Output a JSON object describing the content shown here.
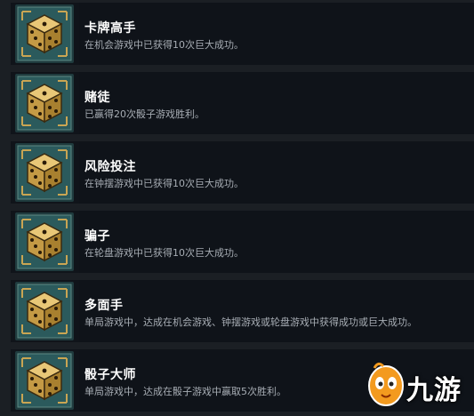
{
  "achievements": [
    {
      "title": "卡牌高手",
      "description": "在机会游戏中已获得10次巨大成功。",
      "icon": "dice-icon"
    },
    {
      "title": "赌徒",
      "description": "已赢得20次骰子游戏胜利。",
      "icon": "dice-icon"
    },
    {
      "title": "风险投注",
      "description": "在钟摆游戏中已获得10次巨大成功。",
      "icon": "dice-icon"
    },
    {
      "title": "骗子",
      "description": "在轮盘游戏中已获得10次巨大成功。",
      "icon": "dice-icon"
    },
    {
      "title": "多面手",
      "description": "单局游戏中，达成在机会游戏、钟摆游戏或轮盘游戏中获得成功或巨大成功。",
      "icon": "dice-icon"
    },
    {
      "title": "骰子大师",
      "description": "单局游戏中，达成在骰子游戏中赢取5次胜利。",
      "icon": "dice-icon"
    }
  ],
  "watermark": {
    "text": "九游",
    "icon": "jiuyou-mascot-logo"
  },
  "colors": {
    "background": "#1b1f24",
    "row_bg": "#0f1319",
    "title": "#ffffff",
    "description": "#a7adb4",
    "icon_gold": "#d8b25a",
    "icon_teal": "#2b5a5c"
  }
}
